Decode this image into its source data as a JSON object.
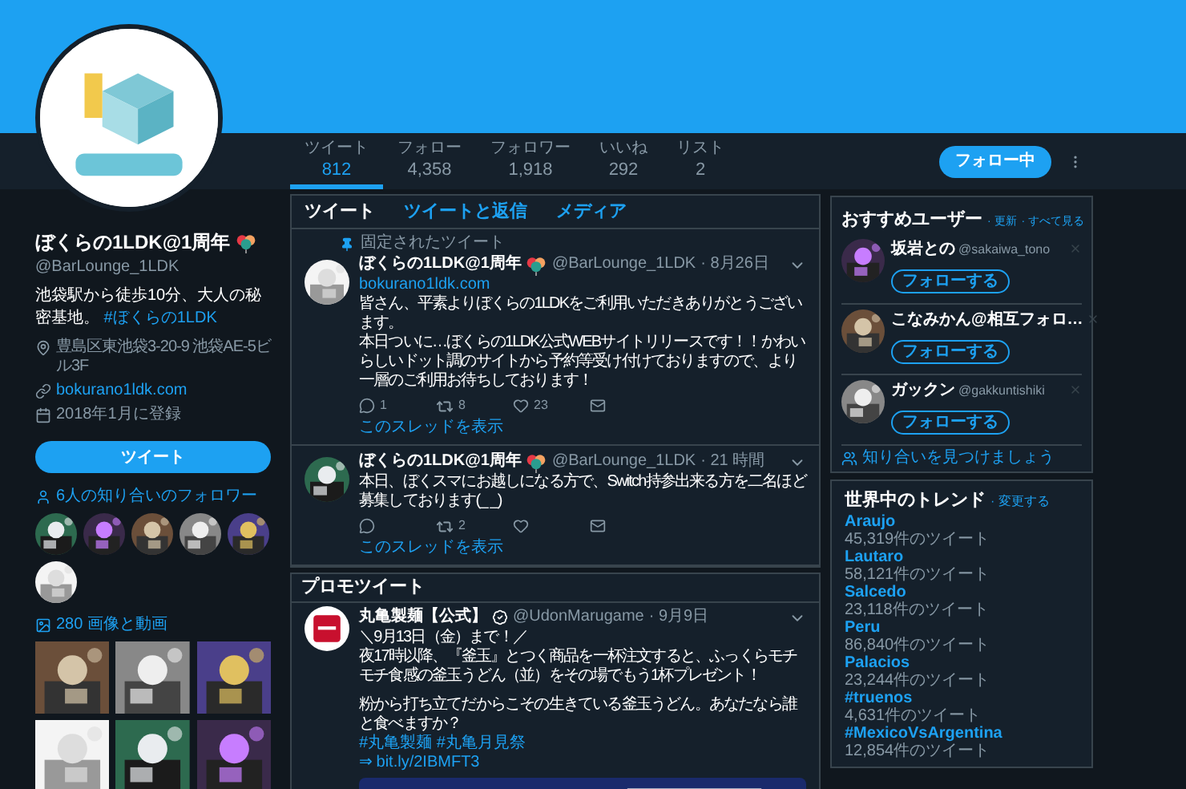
{
  "profile": {
    "name": "ぼくらの1LDK@1周年",
    "handle": "@BarLounge_1LDK",
    "bio": "池袋駅から徒歩10分、大人の秘密基地。 **#ぼくらの1LDK**",
    "location": "豊島区東池袋3-20-9 池袋AE-5ビル3F",
    "url": "bokurano1ldk.com",
    "joined": "2018年1月に登録"
  },
  "tweet_button": "ツイート",
  "known_followers": {
    "label": "6人の知り合いのフォロワー"
  },
  "media": {
    "label": "280 画像と動画"
  },
  "stats": [
    {
      "label": "ツイート",
      "value": "812",
      "selected": true
    },
    {
      "label": "フォロー",
      "value": "4,358",
      "selected": false
    },
    {
      "label": "フォロワー",
      "value": "1,918",
      "selected": false
    },
    {
      "label": "いいね",
      "value": "292",
      "selected": false
    },
    {
      "label": "リスト",
      "value": "2",
      "selected": false
    }
  ],
  "follow_button": "フォロー中",
  "tabs": [
    {
      "label": "ツイート",
      "selected": true
    },
    {
      "label": "ツイートと返信",
      "selected": false
    },
    {
      "label": "メディア",
      "selected": false
    }
  ],
  "tweets": [
    {
      "pinned": true,
      "pinned_label": "固定されたツイート",
      "name": "ぼくらの1LDK@1周年",
      "handle": "@BarLounge_1LDK",
      "time": "· 8月26日",
      "link": "bokurano1ldk.com",
      "paragraphs": [
        "皆さん、平素よりぼくらの1LDKをご利用いただきありがとうございます。",
        "本日ついに…ぼくらの1LDK公式WEBサイトリリースです！！かわいらしいドット調のサイトから予約等受け付けておりますので、より一層のご利用お待ちしております！"
      ],
      "replies": "1",
      "retweets": "8",
      "likes": "23",
      "thread_link": "このスレッドを表示"
    },
    {
      "pinned": false,
      "name": "ぼくらの1LDK@1周年",
      "handle": "@BarLounge_1LDK",
      "time": "· 21 時間",
      "paragraphs": [
        "本日、ぼくスマにお越しになる方で、Switch持参出来る方を二名ほど募集しております(_ _)"
      ],
      "retweets": "2",
      "thread_link": "このスレッドを表示"
    }
  ],
  "promo": {
    "heading": "プロモツイート",
    "name": "丸亀製麺【公式】",
    "verified": true,
    "handle": "@UdonMarugame",
    "time": "· 9月9日",
    "paragraphs": [
      "＼9月13日（金）まで！／",
      "夜17時以降、『釜玉』とつく商品を一杯注文すると、ふっくらモチモチ食感の釜玉うどん（並）をその場でもう1杯プレゼント！",
      "粉から打ち立てだからこその生きている釜玉うどん。あなたなら誰と食べますか？"
    ],
    "hashtags": "#丸亀製麺 #丸亀月見祭",
    "link": "⇒ bit.ly/2IBMFT3"
  },
  "recommended": {
    "title": "おすすめユーザー",
    "refresh": "· 更新",
    "see_all": "· すべて見る",
    "users": [
      {
        "name": "坂岩との",
        "handle": "@sakaiwa_tono",
        "button": "フォローする"
      },
      {
        "name": "こなみかん@相互フォロ…",
        "button": "フォローする"
      },
      {
        "name": "ガックン",
        "handle": "@gakkuntishiki",
        "button": "フォローする"
      }
    ],
    "find_friends": "知り合いを見つけましょう"
  },
  "trends": {
    "title": "世界中のトレンド",
    "change": "· 変更する",
    "items": [
      {
        "name": "Araujo",
        "count": "45,319件のツイート"
      },
      {
        "name": "Lautaro",
        "count": "58,121件のツイート"
      },
      {
        "name": "Salcedo",
        "count": "23,118件のツイート"
      },
      {
        "name": "Peru",
        "count": "86,840件のツイート"
      },
      {
        "name": "Palacios",
        "count": "23,244件のツイート"
      },
      {
        "name": "#truenos",
        "count": "4,631件のツイート"
      },
      {
        "name": "#MexicoVsArgentina",
        "count": "12,854件のツイート"
      }
    ]
  }
}
